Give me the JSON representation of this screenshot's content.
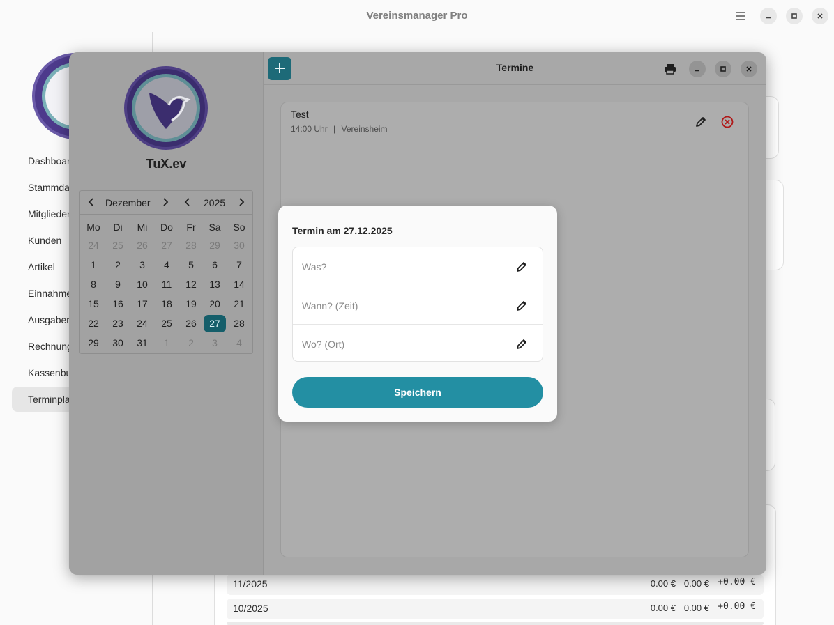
{
  "main_window": {
    "title": "Vereinsmanager Pro",
    "sidebar": {
      "items": [
        {
          "label": "Dashboard"
        },
        {
          "label": "Stammdaten"
        },
        {
          "label": "Mitglieder"
        },
        {
          "label": "Kunden"
        },
        {
          "label": "Artikel"
        },
        {
          "label": "Einnahmen"
        },
        {
          "label": "Ausgaben"
        },
        {
          "label": "Rechnungen"
        },
        {
          "label": "Kassenbuch"
        },
        {
          "label": "Terminplaner"
        }
      ],
      "active_index": 9
    },
    "report_rows": [
      {
        "period": "11/2025",
        "income": "0.00 €",
        "expense": "0.00 €",
        "balance": "+0.00 €"
      },
      {
        "period": "10/2025",
        "income": "0.00 €",
        "expense": "0.00 €",
        "balance": "+0.00 €"
      }
    ]
  },
  "termine_window": {
    "title": "Termine",
    "club_name": "TuX.ev",
    "calendar": {
      "month": "Dezember",
      "year": "2025",
      "weekdays": [
        "Mo",
        "Di",
        "Mi",
        "Do",
        "Fr",
        "Sa",
        "So"
      ],
      "days": [
        [
          "24",
          "25",
          "26",
          "27",
          "28",
          "29",
          "30"
        ],
        [
          "1",
          "2",
          "3",
          "4",
          "5",
          "6",
          "7"
        ],
        [
          "8",
          "9",
          "10",
          "11",
          "12",
          "13",
          "14"
        ],
        [
          "15",
          "16",
          "17",
          "18",
          "19",
          "20",
          "21"
        ],
        [
          "22",
          "23",
          "24",
          "25",
          "26",
          "27",
          "28"
        ],
        [
          "29",
          "30",
          "31",
          "1",
          "2",
          "3",
          "4"
        ]
      ],
      "selected_day": "27"
    },
    "events": [
      {
        "title": "Test",
        "time": "14:00 Uhr",
        "separator": "|",
        "location": "Vereinsheim"
      }
    ]
  },
  "popover": {
    "title": "Termin am 27.12.2025",
    "fields": [
      {
        "placeholder": "Was?",
        "value": ""
      },
      {
        "placeholder": "Wann? (Zeit)",
        "value": ""
      },
      {
        "placeholder": "Wo? (Ort)",
        "value": ""
      }
    ],
    "save_label": "Speichern"
  },
  "colors": {
    "accent": "#238fa3",
    "selected_day": "#155e6a",
    "add_button": "#1d6a78",
    "delete_icon": "#b01818"
  }
}
